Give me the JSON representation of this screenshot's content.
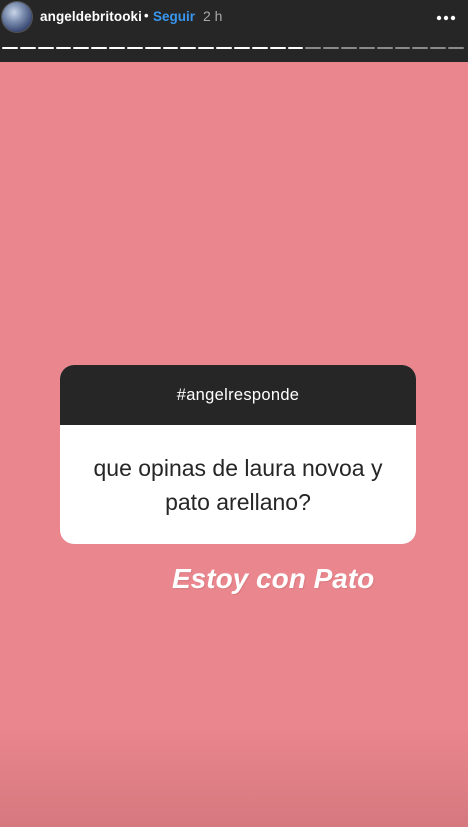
{
  "header": {
    "username": "angeldebritooki",
    "separator": "•",
    "follow_label": "Seguir",
    "time": "2 h",
    "more_icon": "⋮"
  },
  "progress": {
    "segments_total": 26,
    "segments_viewed": 17
  },
  "question": {
    "header": "#angelresponde",
    "text": "que opinas de laura novoa y pato arellano?"
  },
  "answer": {
    "text": "Estoy con Pato"
  },
  "colors": {
    "background": "#ea868d",
    "topbar": "#262626",
    "follow": "#3897f0",
    "progress_viewed": "#ffffff",
    "progress_pending": "#8a8a8a"
  }
}
